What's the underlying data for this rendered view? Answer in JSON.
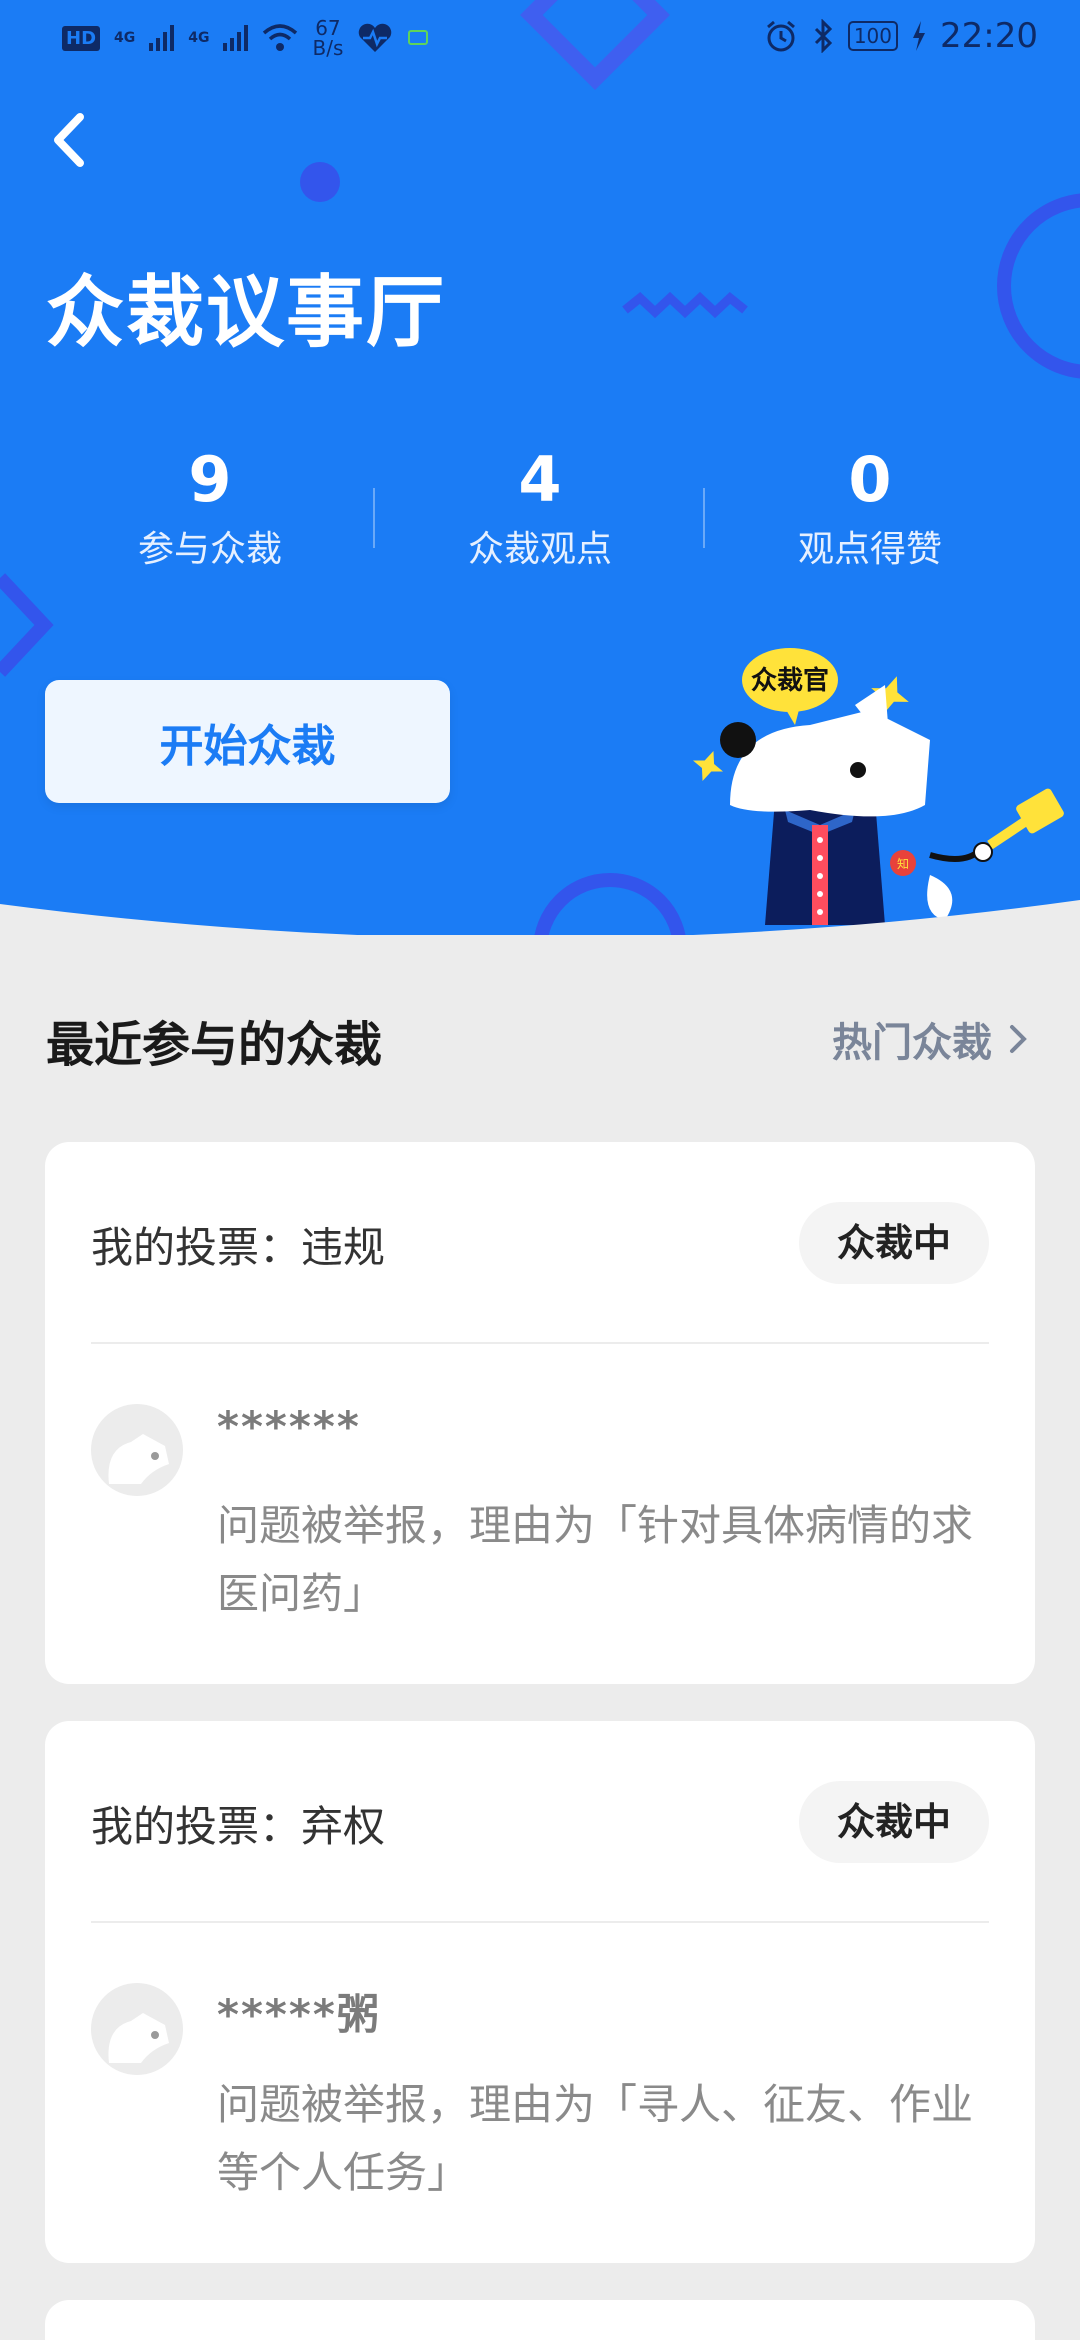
{
  "status_bar": {
    "hd": "HD",
    "net1": "4G",
    "net2": "4G",
    "speed_top": "67",
    "speed_bottom": "B/s",
    "battery": "100",
    "time": "22:20"
  },
  "header": {
    "back_icon": "chevron-left-icon",
    "title": "众裁议事厅"
  },
  "stats": [
    {
      "value": "9",
      "label": "参与众裁"
    },
    {
      "value": "4",
      "label": "众裁观点"
    },
    {
      "value": "0",
      "label": "观点得赞"
    }
  ],
  "start_button": {
    "label": "开始众裁"
  },
  "mascot": {
    "badge_text": "众裁官",
    "chest_mark": "知"
  },
  "section": {
    "title": "最近参与的众裁",
    "hot_link": "热门众裁",
    "hot_link_icon": "chevron-right-icon"
  },
  "cards": [
    {
      "vote": "我的投票：违规",
      "status": "众裁中",
      "user": "******",
      "reason": "问题被举报，理由为「针对具体病情的求医问药」"
    },
    {
      "vote": "我的投票：弃权",
      "status": "众裁中",
      "user": "*****粥",
      "reason": "问题被举报，理由为「寻人、征友、作业等个人任务」"
    }
  ],
  "colors": {
    "brand_blue": "#1b7cf5",
    "background": "#ececec",
    "card": "#ffffff",
    "mascot_navy": "#0c1d5c",
    "mascot_yellow": "#ffe23a"
  }
}
